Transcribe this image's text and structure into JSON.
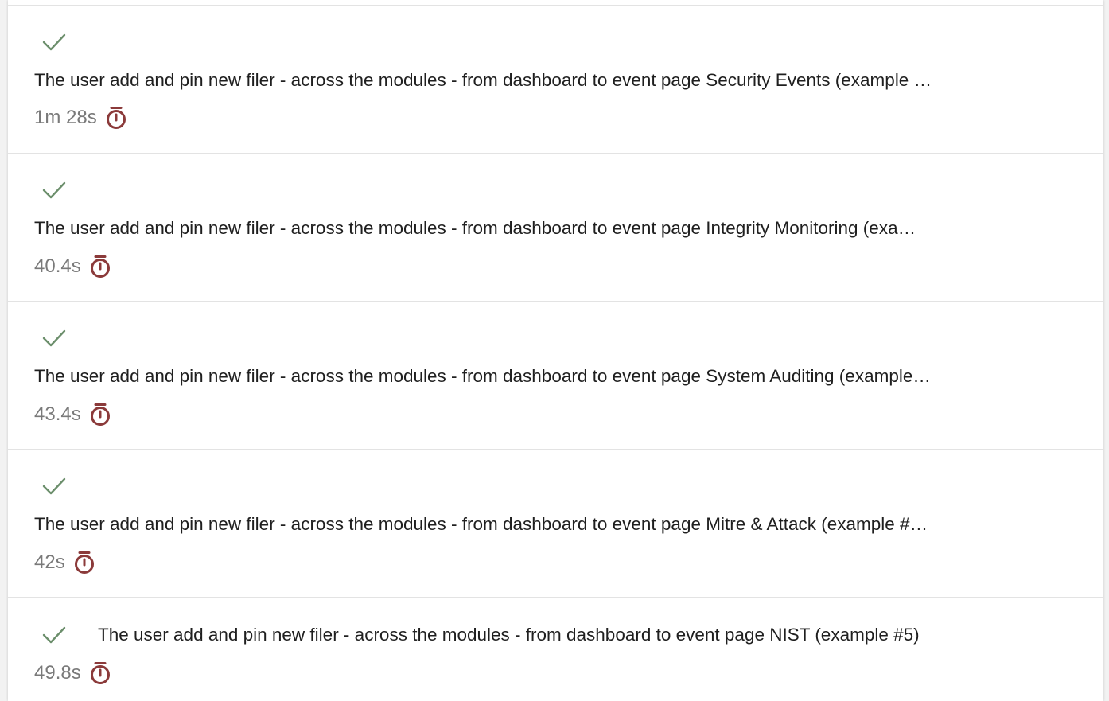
{
  "colors": {
    "pass": "#6b8e6b",
    "timer": "#8b3a3a",
    "duration_text": "#7a7a7a",
    "title_text": "#1f1f1f"
  },
  "tests": [
    {
      "status": "passed",
      "status_icon": "check-icon",
      "title": "The user add and pin new filer - across the modules - from dashboard to event page Security Events (example …",
      "duration": "1m 28s",
      "duration_icon": "stopwatch-icon"
    },
    {
      "status": "passed",
      "status_icon": "check-icon",
      "title": "The user add and pin new filer - across the modules - from dashboard to event page Integrity Monitoring (exa…",
      "duration": "40.4s",
      "duration_icon": "stopwatch-icon"
    },
    {
      "status": "passed",
      "status_icon": "check-icon",
      "title": "The user add and pin new filer - across the modules - from dashboard to event page System Auditing (example…",
      "duration": "43.4s",
      "duration_icon": "stopwatch-icon"
    },
    {
      "status": "passed",
      "status_icon": "check-icon",
      "title": "The user add and pin new filer - across the modules - from dashboard to event page Mitre & Attack (example #…",
      "duration": "42s",
      "duration_icon": "stopwatch-icon"
    },
    {
      "status": "passed",
      "status_icon": "check-icon",
      "title": "The user add and pin new filer - across the modules - from dashboard to event page NIST (example #5)",
      "duration": "49.8s",
      "duration_icon": "stopwatch-icon"
    }
  ]
}
